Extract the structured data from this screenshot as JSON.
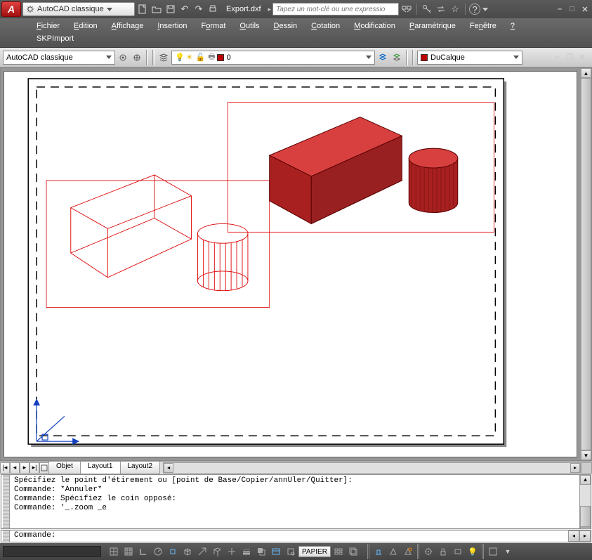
{
  "title": {
    "workspace": "AutoCAD classique",
    "filename": "Export.dxf",
    "search_placeholder": "Tapez un mot-clé ou une expressio"
  },
  "menu": {
    "items": [
      "Fichier",
      "Edition",
      "Affichage",
      "Insertion",
      "Format",
      "Outils",
      "Dessin",
      "Cotation",
      "Modification",
      "Paramétrique",
      "Fenêtre",
      "?"
    ],
    "extra": "SKPImport"
  },
  "toolbar": {
    "workspace": "AutoCAD classique",
    "layer": "0",
    "bylayer": "DuCalque"
  },
  "tabs": {
    "model": "Objet",
    "l1": "Layout1",
    "l2": "Layout2"
  },
  "command_history": [
    "Spécifiez le point d'étirement ou [point de Base/Copier/annUler/Quitter]:",
    "Commande: *Annuler*",
    "Commande: Spécifiez le coin opposé:",
    "Commande: '_.zoom _e"
  ],
  "command_prompt": "Commande:",
  "status": {
    "paper": "PAPIER"
  }
}
